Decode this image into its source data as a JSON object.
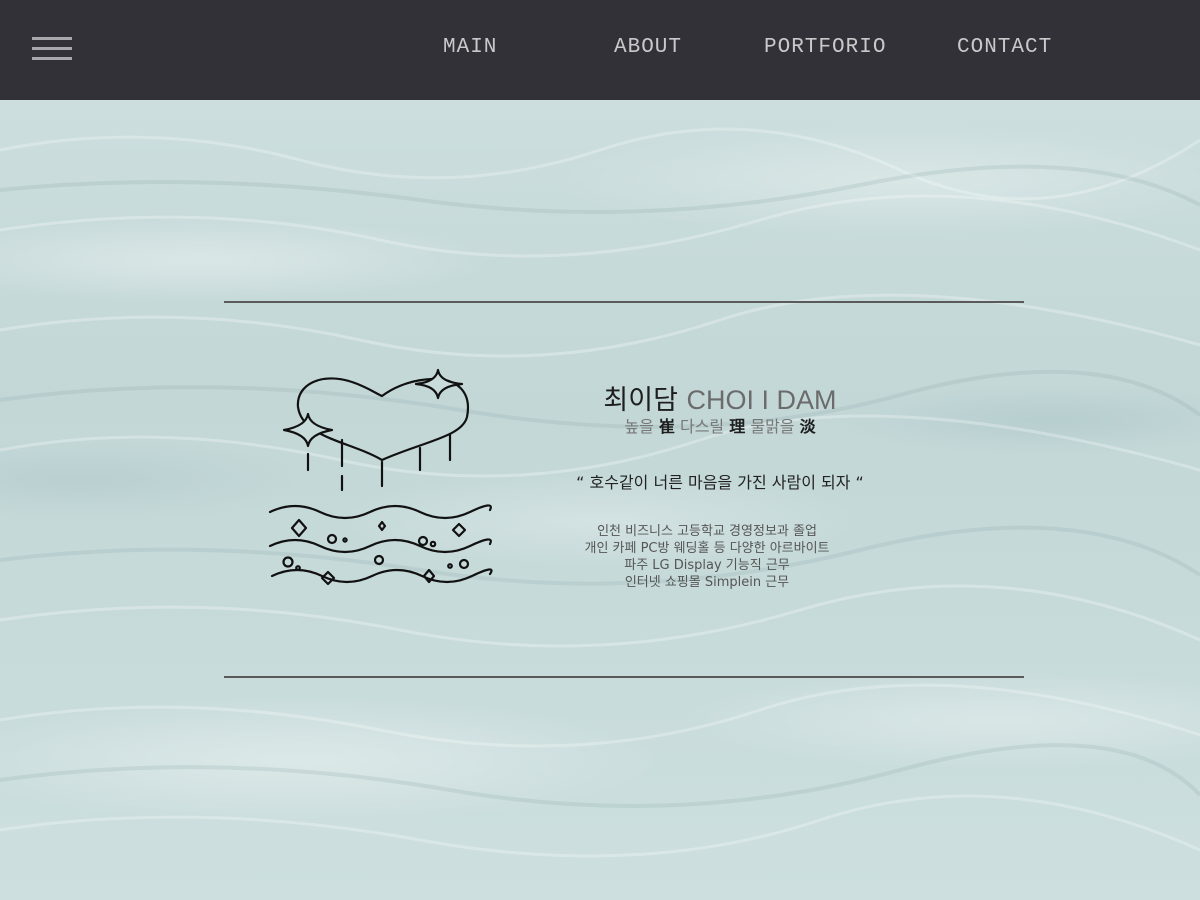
{
  "nav": {
    "menu_icon": "hamburger-icon",
    "links": [
      "MAIN",
      "ABOUT",
      "PORTFORIO",
      "CONTACT"
    ]
  },
  "profile": {
    "name_kr": "최이담",
    "name_en": "CHOI I DAM",
    "motto": {
      "p1": "높을 ",
      "h1": "崔",
      "p2": " 다스릴 ",
      "h2": "理",
      "p3": " 물맑을 ",
      "h3": "淡"
    },
    "quote": "“ 호수같이 너른 마음을 가진 사람이 되자 “",
    "history": [
      "인천 비즈니스 고등학교 경영정보과 졸업",
      "개인 카페 PC방 웨딩홀 등 다양한 아르바이트",
      "파주 LG Display 기능직 근무",
      "인터넷 쇼핑몰 Simplein 근무"
    ],
    "logo_icon": "heart-lake-logo-icon"
  },
  "colors": {
    "navbar": "#323137",
    "nav_text": "#c9c9cc",
    "background": "#c8dcdc",
    "rule": "#5a5a5a"
  }
}
